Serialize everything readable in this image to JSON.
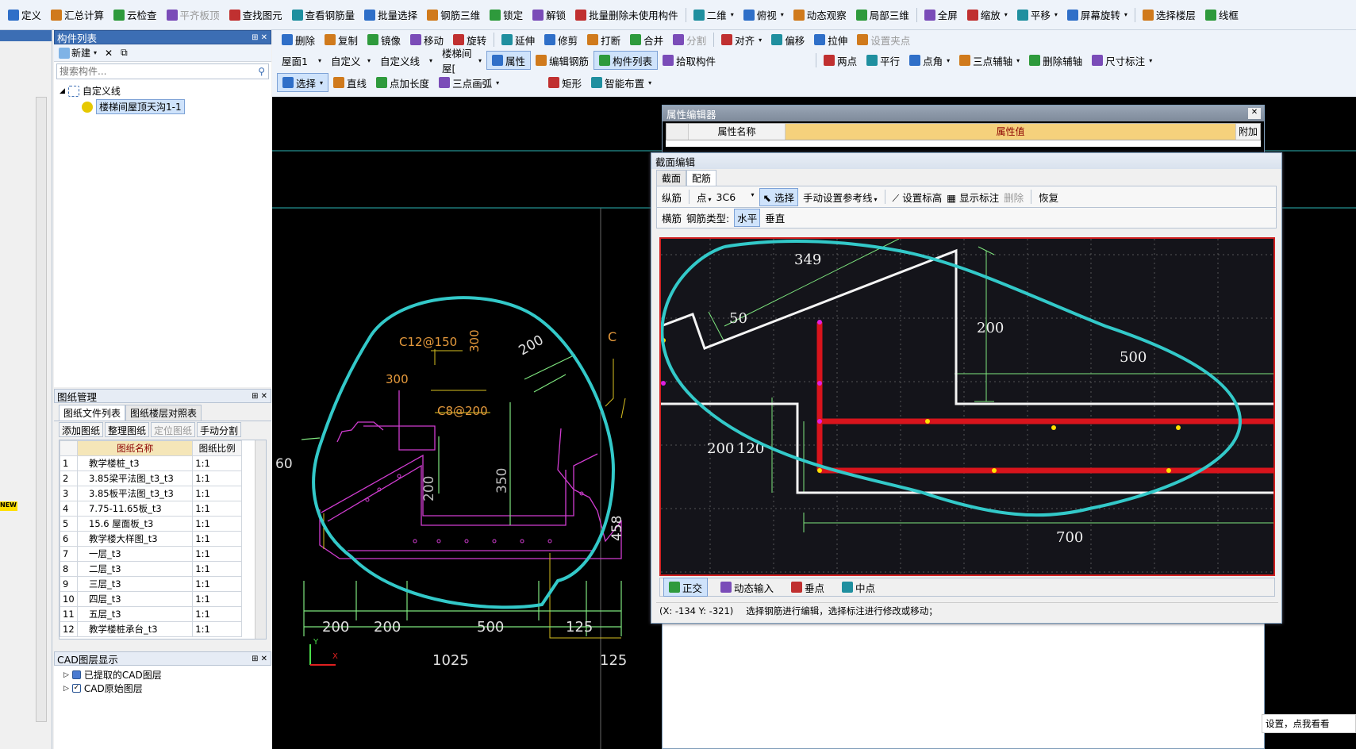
{
  "toolbar1": {
    "items": [
      "定义",
      "汇总计算",
      "云检查",
      "平齐板顶",
      "查找图元",
      "查看钢筋量",
      "批量选择",
      "钢筋三维",
      "锁定",
      "解锁",
      "批量删除未使用构件",
      "二维",
      "俯视",
      "动态观察",
      "局部三维",
      "全屏",
      "缩放",
      "平移",
      "屏幕旋转",
      "选择楼层",
      "线框"
    ]
  },
  "toolbar2": {
    "items": [
      "删除",
      "复制",
      "镜像",
      "移动",
      "旋转",
      "延伸",
      "修剪",
      "打断",
      "合并",
      "分割",
      "对齐",
      "偏移",
      "拉伸",
      "设置夹点"
    ]
  },
  "toolbar3": {
    "floor": "屋面1",
    "type1": "自定义",
    "type2": "自定义线",
    "component": "楼梯间屋[",
    "items": [
      "属性",
      "编辑钢筋",
      "构件列表",
      "拾取构件",
      "两点",
      "平行",
      "点角",
      "三点辅轴",
      "删除辅轴",
      "尺寸标注"
    ]
  },
  "toolbar4": {
    "items": [
      "选择",
      "直线",
      "点加长度",
      "三点画弧",
      "矩形",
      "智能布置"
    ]
  },
  "component_list": {
    "title": "构件列表",
    "new_label": "新建",
    "search_placeholder": "搜索构件...",
    "tree_root": "自定义线",
    "tree_child": "楼梯间屋顶天沟1-1"
  },
  "drawing_mgmt": {
    "title": "图纸管理",
    "tabs": [
      "图纸文件列表",
      "图纸楼层对照表"
    ],
    "buttons": [
      "添加图纸",
      "整理图纸",
      "定位图纸",
      "手动分割"
    ],
    "headers": [
      "图纸名称",
      "图纸比例"
    ],
    "rows": [
      [
        "1",
        "教学楼桩_t3",
        "1:1"
      ],
      [
        "2",
        "3.85梁平法图_t3_t3",
        "1:1"
      ],
      [
        "3",
        "3.85板平法图_t3_t3",
        "1:1"
      ],
      [
        "4",
        "7.75-11.65板_t3",
        "1:1"
      ],
      [
        "5",
        "15.6 屋面板_t3",
        "1:1"
      ],
      [
        "6",
        "教学楼大样图_t3",
        "1:1"
      ],
      [
        "7",
        "一层_t3",
        "1:1"
      ],
      [
        "8",
        "二层_t3",
        "1:1"
      ],
      [
        "9",
        "三层_t3",
        "1:1"
      ],
      [
        "10",
        "四层_t3",
        "1:1"
      ],
      [
        "11",
        "五层_t3",
        "1:1"
      ],
      [
        "12",
        "教学楼桩承台_t3",
        "1:1"
      ]
    ]
  },
  "cad_layers": {
    "title": "CAD图层显示",
    "items": [
      "已提取的CAD图层",
      "CAD原始图层"
    ]
  },
  "cad_drawing": {
    "labels": [
      "C12@150",
      "300",
      "300",
      "200",
      "C8@200",
      "350",
      "200",
      "60",
      "458",
      "C"
    ],
    "dims": [
      "200",
      "200",
      "500",
      "125",
      "1025",
      "125"
    ],
    "new_badge": "NEW"
  },
  "prop_editor": {
    "title": "属性编辑器",
    "headers": [
      "属性名称",
      "属性值",
      "附加"
    ]
  },
  "section_editor": {
    "title": "截面编辑",
    "tabs": [
      "截面",
      "配筋"
    ],
    "row1": {
      "label": "纵筋",
      "mode": "点",
      "spec": "3C6",
      "select": "选择",
      "ref": "手动设置参考线",
      "elev": "设置标高",
      "show": "显示标注",
      "del": "删除",
      "restore": "恢复"
    },
    "row2": {
      "label": "横筋",
      "type_label": "钢筋类型:",
      "h": "水平",
      "v": "垂直"
    },
    "dims": [
      "349",
      "50",
      "200",
      "500",
      "200",
      "120",
      "700"
    ],
    "status_btns": [
      "正交",
      "动态输入",
      "垂点",
      "中点"
    ],
    "coords": "(X: -134 Y: -321)",
    "hint": "选择钢筋进行编辑，选择标注进行修改或移动；"
  },
  "bottom_hint": "设置，点我看看",
  "colors": {
    "cyan": "#33c9c9",
    "red": "#d8141c",
    "green": "#7ee67e",
    "magenta": "#d03cd0"
  }
}
